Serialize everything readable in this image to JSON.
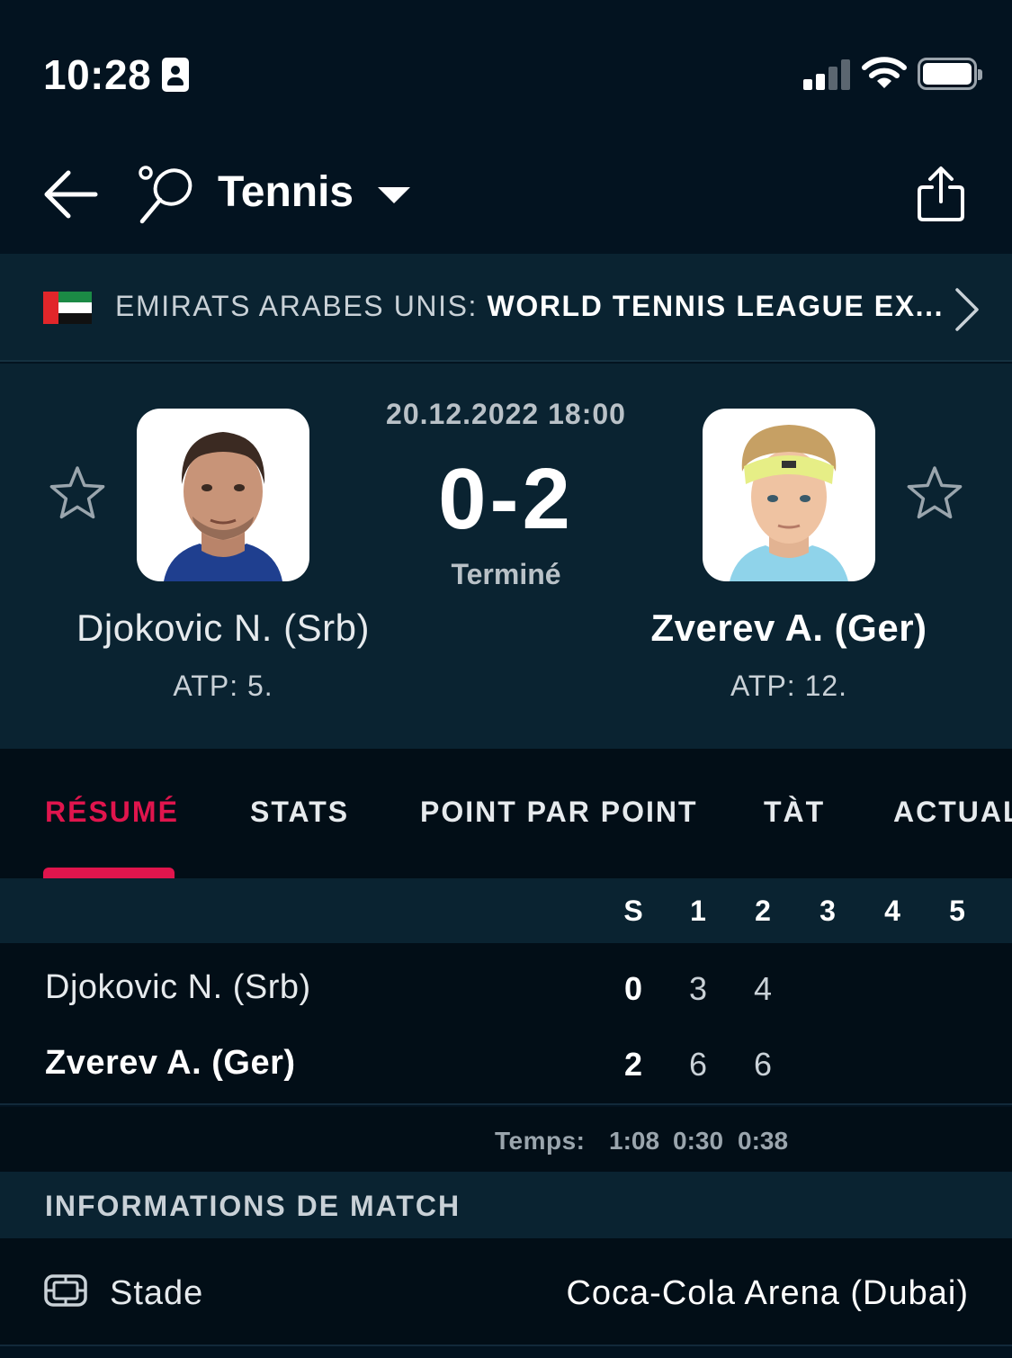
{
  "status_bar": {
    "time": "10:28",
    "icons": [
      "contact-card-icon",
      "signal-icon",
      "wifi-icon",
      "battery-icon"
    ]
  },
  "header": {
    "sport_label": "Tennis",
    "icons": [
      "back-arrow-icon",
      "tennis-racket-icon",
      "dropdown-icon",
      "share-icon"
    ]
  },
  "tournament": {
    "flag": "uae-flag-icon",
    "country": "EMIRATS ARABES UNIS: ",
    "name": "WORLD TENNIS LEAGUE EX..."
  },
  "match": {
    "date_time": "20.12.2022 18:00",
    "score": "0-2",
    "status": "Terminé",
    "home": {
      "name": "Djokovic N. (Srb)",
      "rank": "ATP: 5."
    },
    "away": {
      "name": "Zverev A. (Ger)",
      "rank": "ATP: 12."
    }
  },
  "tabs": [
    {
      "label": "RÉSUMÉ",
      "active": true
    },
    {
      "label": "STATS",
      "active": false
    },
    {
      "label": "POINT PAR POINT",
      "active": false
    },
    {
      "label": "TÀT",
      "active": false
    },
    {
      "label": "ACTUAL",
      "active": false
    }
  ],
  "scoreboard": {
    "columns": [
      "S",
      "1",
      "2",
      "3",
      "4",
      "5"
    ],
    "rows": [
      {
        "player": "Djokovic N. (Srb)",
        "sets": "0",
        "set1": "3",
        "set2": "4"
      },
      {
        "player": "Zverev A. (Ger)",
        "sets": "2",
        "set1": "6",
        "set2": "6"
      }
    ],
    "time_label": "Temps:",
    "times": [
      "1:08",
      "0:30",
      "0:38"
    ]
  },
  "match_info": {
    "title": "INFORMATIONS DE MATCH",
    "venue_label": "Stade",
    "venue_value": "Coca-Cola Arena (Dubai)"
  },
  "colors": {
    "background": "#031320",
    "panel": "#0a2331",
    "accent": "#e0154d"
  }
}
